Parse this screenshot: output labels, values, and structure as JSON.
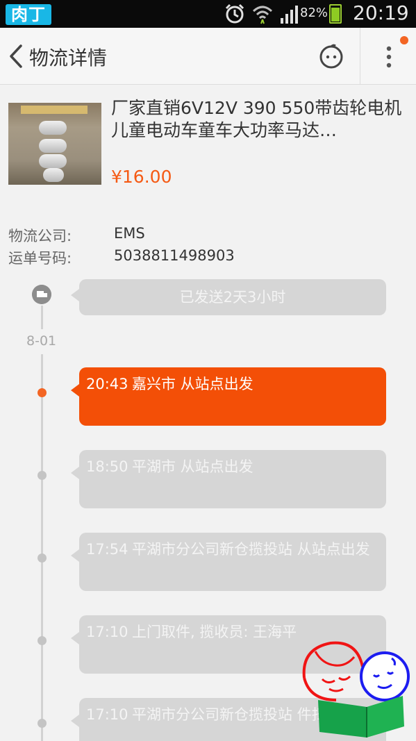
{
  "status_bar": {
    "logo_text": "肉丁",
    "battery_percent": "82%",
    "battery_level": 0.82,
    "time": "20:19",
    "icons": [
      "alarm-icon",
      "wifi-icon",
      "signal-icon",
      "battery-icon"
    ]
  },
  "header": {
    "title": "物流详情",
    "back_icon": "chevron-left-icon",
    "face_icon": "smiley-face-icon",
    "more_icon": "more-vertical-icon",
    "badge_color": "#f36523"
  },
  "product": {
    "title": "厂家直销6V12V 390 550带齿轮电机 儿童电动车童车大功率马达…",
    "price": "¥16.00"
  },
  "logistics": {
    "company_label": "物流公司:",
    "company_value": "EMS",
    "tracking_label": "运单号码:",
    "tracking_value": "5038811498903"
  },
  "timeline": {
    "summary": "已发送2天3小时",
    "date": "8-01",
    "events": [
      {
        "time": "20:43",
        "desc": "嘉兴市 从站点出发",
        "active": true
      },
      {
        "time": "18:50",
        "desc": "平湖市 从站点出发",
        "active": false
      },
      {
        "time": "17:54",
        "desc": "平湖市分公司新仓揽投站 从站点出发",
        "active": false
      },
      {
        "time": "17:10",
        "desc": "上门取件, 揽收员: 王海平",
        "active": false
      },
      {
        "time": "17:10",
        "desc": "平湖市分公司新仓揽投站 件扫描",
        "active": false
      }
    ]
  },
  "colors": {
    "accent": "#f34f07",
    "price": "#f55a14",
    "card_inactive": "#d6d6d6",
    "background": "#f2f2f2"
  }
}
